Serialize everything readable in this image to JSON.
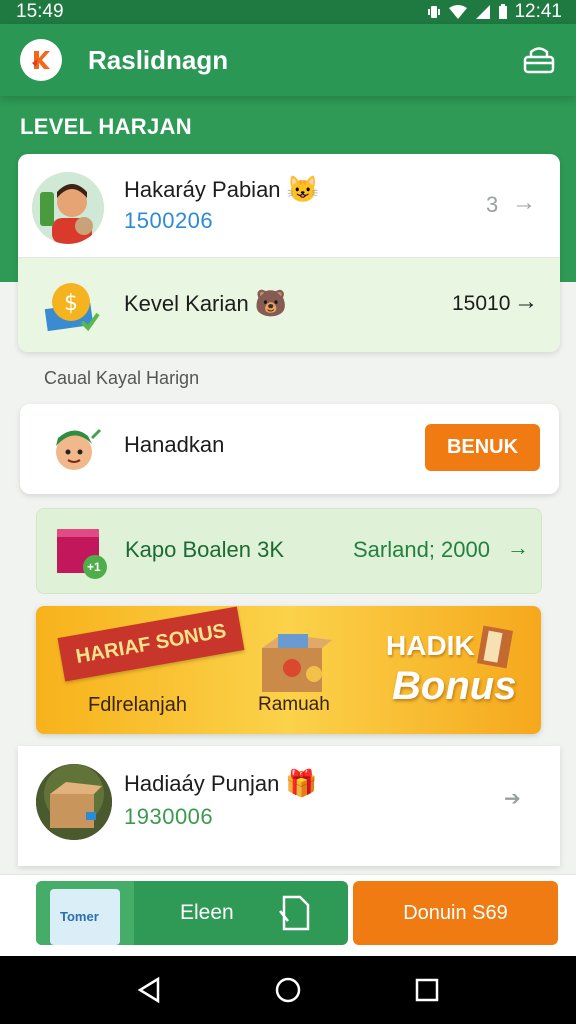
{
  "status_bar": {
    "time_left": "15:49",
    "time_right": "12:41"
  },
  "app_bar": {
    "title": "Raslidnagn",
    "logo_icon": "k-logo-icon",
    "action_icon": "basket-icon"
  },
  "section": {
    "title": "LEVEL HARJAN"
  },
  "card1": {
    "row1": {
      "title": "Hakaráy Pabian",
      "emoji": "😺",
      "value": "1500206",
      "count": "3",
      "arrow": "→"
    },
    "row2": {
      "title": "Kevel Karian",
      "emoji": "🐻",
      "value": "15010",
      "arrow": "→"
    }
  },
  "subheading": "Caual Kayal Harign",
  "card2": {
    "title": "Hanadkan",
    "button": "BENUK"
  },
  "promo": {
    "title": "Kapo Boalen 3K",
    "reward": "Sarland; 2000",
    "arrow": "→",
    "badge": "+1"
  },
  "banner": {
    "ribbon": "HARIAF SONUS",
    "left_label": "Fdlrelanjah",
    "mid_label": "Ramuah",
    "right_title": "HADIK",
    "right_sub": "Bonus"
  },
  "card3": {
    "title": "Hadiaáy Punjan",
    "emoji": "🎁",
    "value": "1930006",
    "arrow": "➔"
  },
  "bottom_bar": {
    "left_button": "Eleen",
    "right_button": "Donuin S69",
    "thumb_text": "Tomer"
  },
  "nav": {
    "back_icon": "back-icon",
    "home_icon": "home-icon",
    "recents_icon": "recents-icon"
  },
  "colors": {
    "primary_green": "#2e9a55",
    "accent_orange": "#ef7b12",
    "promo_bg": "#dff2d8",
    "number_blue": "#2b8bd6"
  }
}
